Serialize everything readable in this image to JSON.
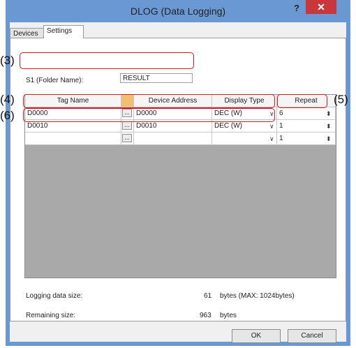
{
  "window": {
    "title": "DLOG (Data Logging)",
    "help_label": "?",
    "close_label": "✕"
  },
  "tabs": [
    {
      "label": "Devices"
    },
    {
      "label": "Settings"
    }
  ],
  "settings": {
    "folder_label": "S1 (Folder Name):",
    "folder_value": "RESULT"
  },
  "table": {
    "headers": [
      "Tag Name",
      "",
      "Device Address",
      "Display Type",
      "Repeat"
    ],
    "rows": [
      {
        "tag": "D0000",
        "ellipsis": "...",
        "address": "D0000",
        "display": "DEC (W)",
        "repeat": "6"
      },
      {
        "tag": "D0010",
        "ellipsis": "...",
        "address": "D0010",
        "display": "DEC (W)",
        "repeat": "1"
      },
      {
        "tag": "",
        "ellipsis": "...",
        "address": "",
        "display": "",
        "repeat": "1"
      }
    ]
  },
  "info": {
    "logging_label": "Logging data size:",
    "logging_value": "61",
    "logging_unit": "bytes (MAX: 1024bytes)",
    "remaining_label": "Remaining size:",
    "remaining_value": "963",
    "remaining_unit": "bytes"
  },
  "buttons": {
    "ok": "OK",
    "cancel": "Cancel"
  },
  "callouts": {
    "c3": "(3)",
    "c4": "(4)",
    "c5": "(5)",
    "c6": "(6)"
  },
  "colors": {
    "frame": "#6a98d2",
    "close": "#c7373b",
    "highlight": "#d11a2a",
    "grid_bg": "#a9a9a9",
    "ellipsis_col": "#f0c070"
  },
  "icons": {
    "ellipsis": "ellipsis-icon",
    "chevron": "chevron-down-icon",
    "spinner": "spinner-icon"
  }
}
